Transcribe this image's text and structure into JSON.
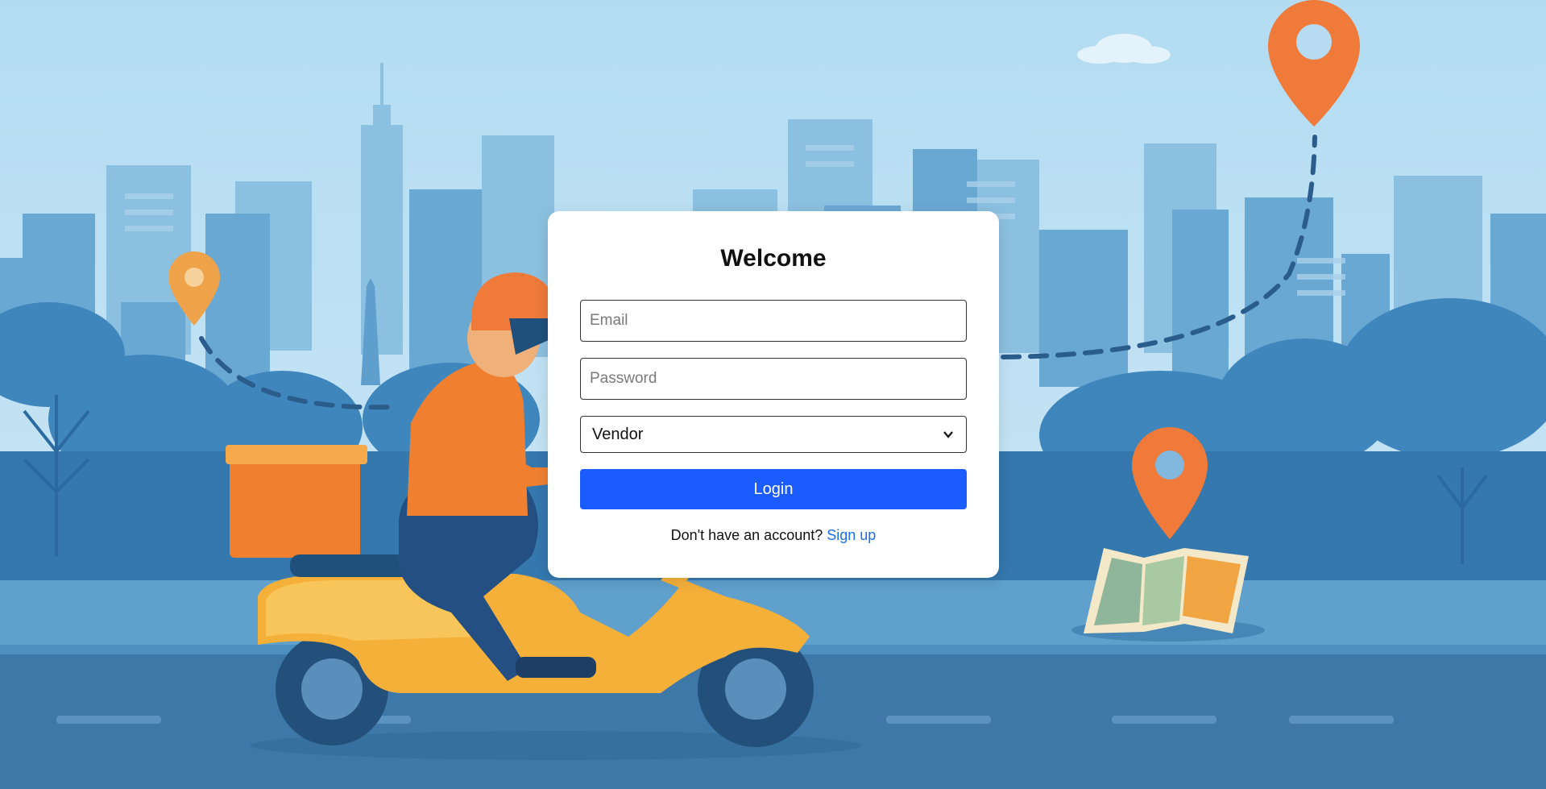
{
  "login_card": {
    "title": "Welcome",
    "email_placeholder": "Email",
    "email_value": "",
    "password_placeholder": "Password",
    "password_value": "",
    "role_selected": "Vendor",
    "login_label": "Login",
    "signup_prompt": "Don't have an account?",
    "signup_link": "Sign up"
  },
  "icons": {
    "role_dropdown": "chevron-down-icon",
    "background_pins": "location-pin-icon",
    "background_map": "folded-map-icon"
  },
  "colors": {
    "accent": "#1a5cff",
    "link": "#1a6fe8",
    "pin": "#f08030",
    "sky": "#bfe0f4",
    "road": "#3d78a8"
  }
}
